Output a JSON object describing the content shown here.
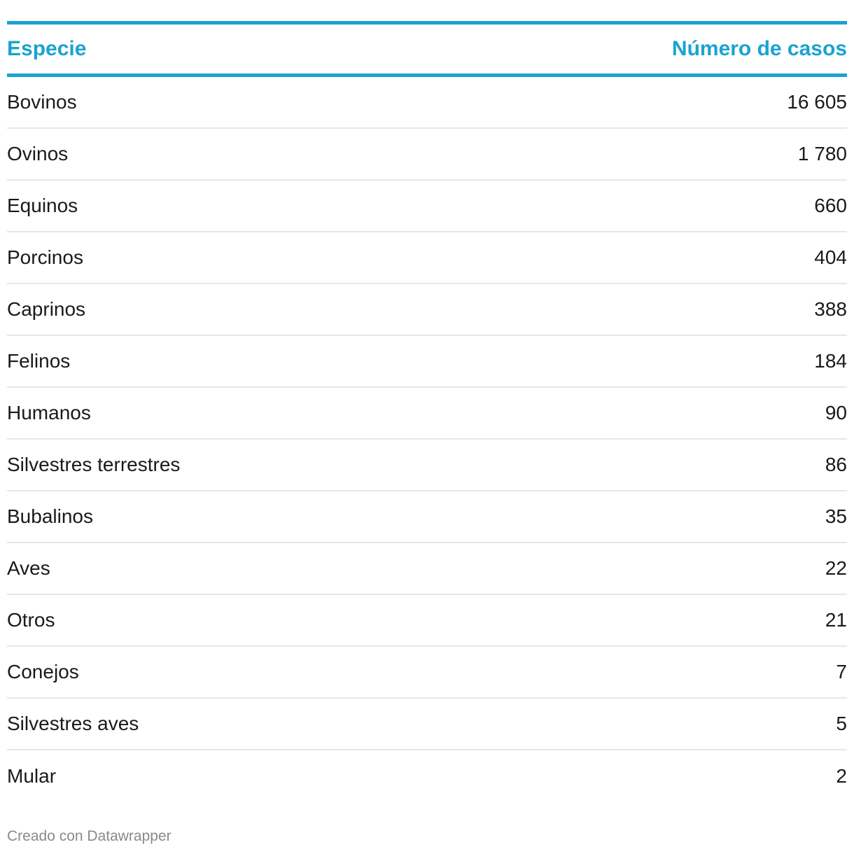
{
  "chart_data": {
    "type": "table",
    "columns": [
      "Especie",
      "Número de casos"
    ],
    "rows": [
      {
        "label": "Bovinos",
        "value": "16 605"
      },
      {
        "label": "Ovinos",
        "value": "1 780"
      },
      {
        "label": "Equinos",
        "value": "660"
      },
      {
        "label": "Porcinos",
        "value": "404"
      },
      {
        "label": "Caprinos",
        "value": "388"
      },
      {
        "label": "Felinos",
        "value": "184"
      },
      {
        "label": "Humanos",
        "value": "90"
      },
      {
        "label": "Silvestres terrestres",
        "value": "86"
      },
      {
        "label": "Bubalinos",
        "value": "35"
      },
      {
        "label": "Aves",
        "value": "22"
      },
      {
        "label": "Otros",
        "value": "21"
      },
      {
        "label": "Conejos",
        "value": "7"
      },
      {
        "label": "Silvestres aves",
        "value": "5"
      },
      {
        "label": "Mular",
        "value": "2"
      }
    ]
  },
  "footer": {
    "credit": "Creado con Datawrapper"
  },
  "colors": {
    "accent": "#1aa3cf",
    "divider": "#e6e6e6",
    "footer_text": "#8a8a8a"
  }
}
